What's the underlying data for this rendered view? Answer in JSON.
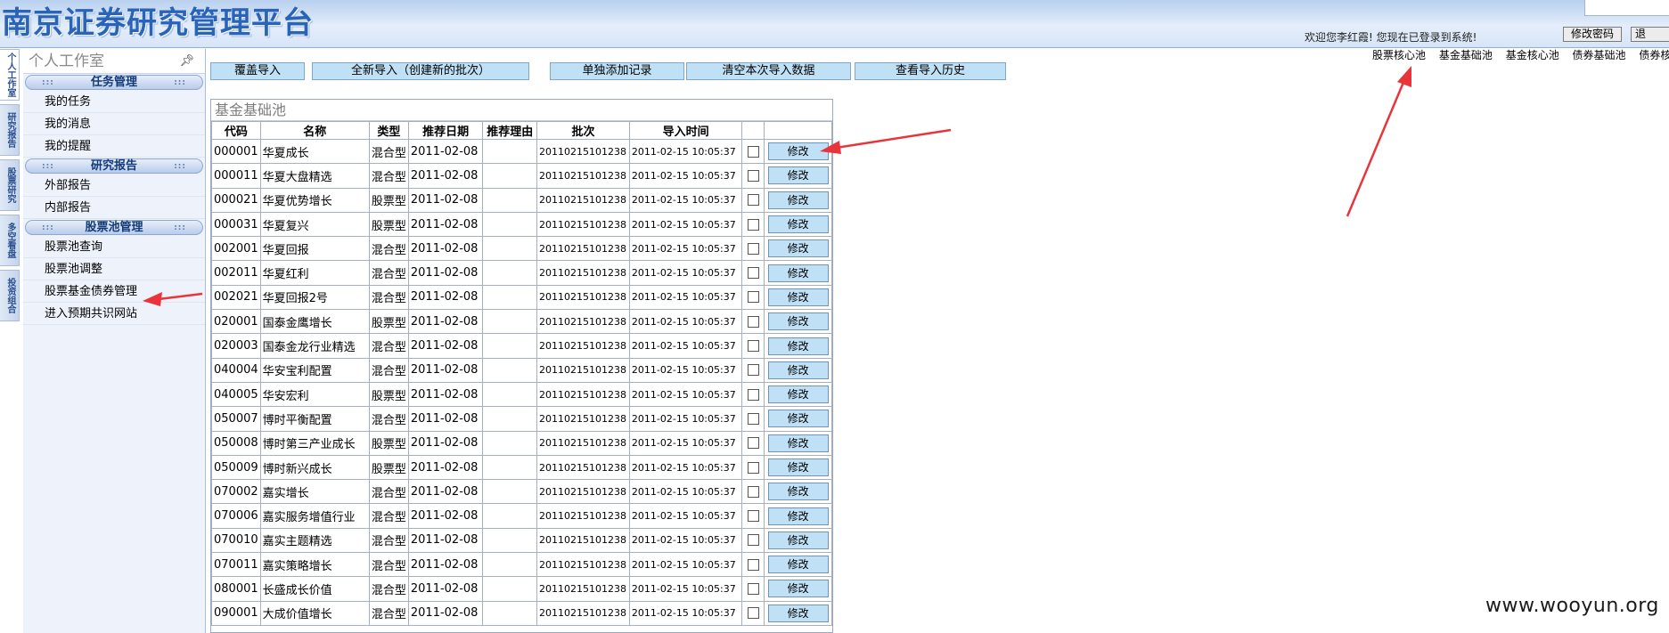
{
  "header": {
    "brand": "南京证券研究管理平台",
    "welcome": "欢迎您李红霞!  您现在已登录到系统!",
    "change_password": "修改密码",
    "logout": "退"
  },
  "pool_nav": [
    "股票核心池",
    "基金基础池",
    "基金核心池",
    "债券基础池",
    "债券核心"
  ],
  "vtabs": [
    "个人工作室",
    "研究报告",
    "股票研究",
    "多空看盘",
    "投资组合"
  ],
  "sidebar": {
    "title": "个人工作室",
    "pin_icon": "pin-icon",
    "sections": [
      {
        "label": "任务管理",
        "items": [
          "我的任务",
          "我的消息",
          "我的提醒"
        ]
      },
      {
        "label": "研究报告",
        "items": [
          "外部报告",
          "内部报告"
        ]
      },
      {
        "label": "股票池管理",
        "items": [
          "股票池查询",
          "股票池调整",
          "股票基金债券管理",
          "进入预期共识网站"
        ]
      }
    ]
  },
  "toolbar": {
    "buttons": [
      "覆盖导入",
      "全新导入（创建新的批次）",
      "单独添加记录",
      "清空本次导入数据",
      "查看导入历史"
    ]
  },
  "panel": {
    "title": "基金基础池",
    "columns": [
      "代码",
      "名称",
      "类型",
      "推荐日期",
      "推荐理由",
      "批次",
      "导入时间",
      "",
      ""
    ],
    "edit_label": "修改",
    "rows": [
      [
        "000001",
        "华夏成长",
        "混合型",
        "2011-02-08",
        "",
        "20110215101238",
        "2011-02-15 10:05:37"
      ],
      [
        "000011",
        "华夏大盘精选",
        "混合型",
        "2011-02-08",
        "",
        "20110215101238",
        "2011-02-15 10:05:37"
      ],
      [
        "000021",
        "华夏优势增长",
        "股票型",
        "2011-02-08",
        "",
        "20110215101238",
        "2011-02-15 10:05:37"
      ],
      [
        "000031",
        "华夏复兴",
        "股票型",
        "2011-02-08",
        "",
        "20110215101238",
        "2011-02-15 10:05:37"
      ],
      [
        "002001",
        "华夏回报",
        "混合型",
        "2011-02-08",
        "",
        "20110215101238",
        "2011-02-15 10:05:37"
      ],
      [
        "002011",
        "华夏红利",
        "混合型",
        "2011-02-08",
        "",
        "20110215101238",
        "2011-02-15 10:05:37"
      ],
      [
        "002021",
        "华夏回报2号",
        "混合型",
        "2011-02-08",
        "",
        "20110215101238",
        "2011-02-15 10:05:37"
      ],
      [
        "020001",
        "国泰金鹰增长",
        "股票型",
        "2011-02-08",
        "",
        "20110215101238",
        "2011-02-15 10:05:37"
      ],
      [
        "020003",
        "国泰金龙行业精选",
        "混合型",
        "2011-02-08",
        "",
        "20110215101238",
        "2011-02-15 10:05:37"
      ],
      [
        "040004",
        "华安宝利配置",
        "混合型",
        "2011-02-08",
        "",
        "20110215101238",
        "2011-02-15 10:05:37"
      ],
      [
        "040005",
        "华安宏利",
        "股票型",
        "2011-02-08",
        "",
        "20110215101238",
        "2011-02-15 10:05:37"
      ],
      [
        "050007",
        "博时平衡配置",
        "混合型",
        "2011-02-08",
        "",
        "20110215101238",
        "2011-02-15 10:05:37"
      ],
      [
        "050008",
        "博时第三产业成长",
        "股票型",
        "2011-02-08",
        "",
        "20110215101238",
        "2011-02-15 10:05:37"
      ],
      [
        "050009",
        "博时新兴成长",
        "股票型",
        "2011-02-08",
        "",
        "20110215101238",
        "2011-02-15 10:05:37"
      ],
      [
        "070002",
        "嘉实增长",
        "混合型",
        "2011-02-08",
        "",
        "20110215101238",
        "2011-02-15 10:05:37"
      ],
      [
        "070006",
        "嘉实服务增值行业",
        "混合型",
        "2011-02-08",
        "",
        "20110215101238",
        "2011-02-15 10:05:37"
      ],
      [
        "070010",
        "嘉实主题精选",
        "混合型",
        "2011-02-08",
        "",
        "20110215101238",
        "2011-02-15 10:05:37"
      ],
      [
        "070011",
        "嘉实策略增长",
        "混合型",
        "2011-02-08",
        "",
        "20110215101238",
        "2011-02-15 10:05:37"
      ],
      [
        "080001",
        "长盛成长价值",
        "混合型",
        "2011-02-08",
        "",
        "20110215101238",
        "2011-02-15 10:05:37"
      ],
      [
        "090001",
        "大成价值增长",
        "混合型",
        "2011-02-08",
        "",
        "20110215101238",
        "2011-02-15 10:05:37"
      ]
    ]
  },
  "watermark": "www.wooyun.org",
  "colors": {
    "arrow": "#e8343a",
    "button": "#bfe0f5",
    "header": "#b8d0ef"
  }
}
